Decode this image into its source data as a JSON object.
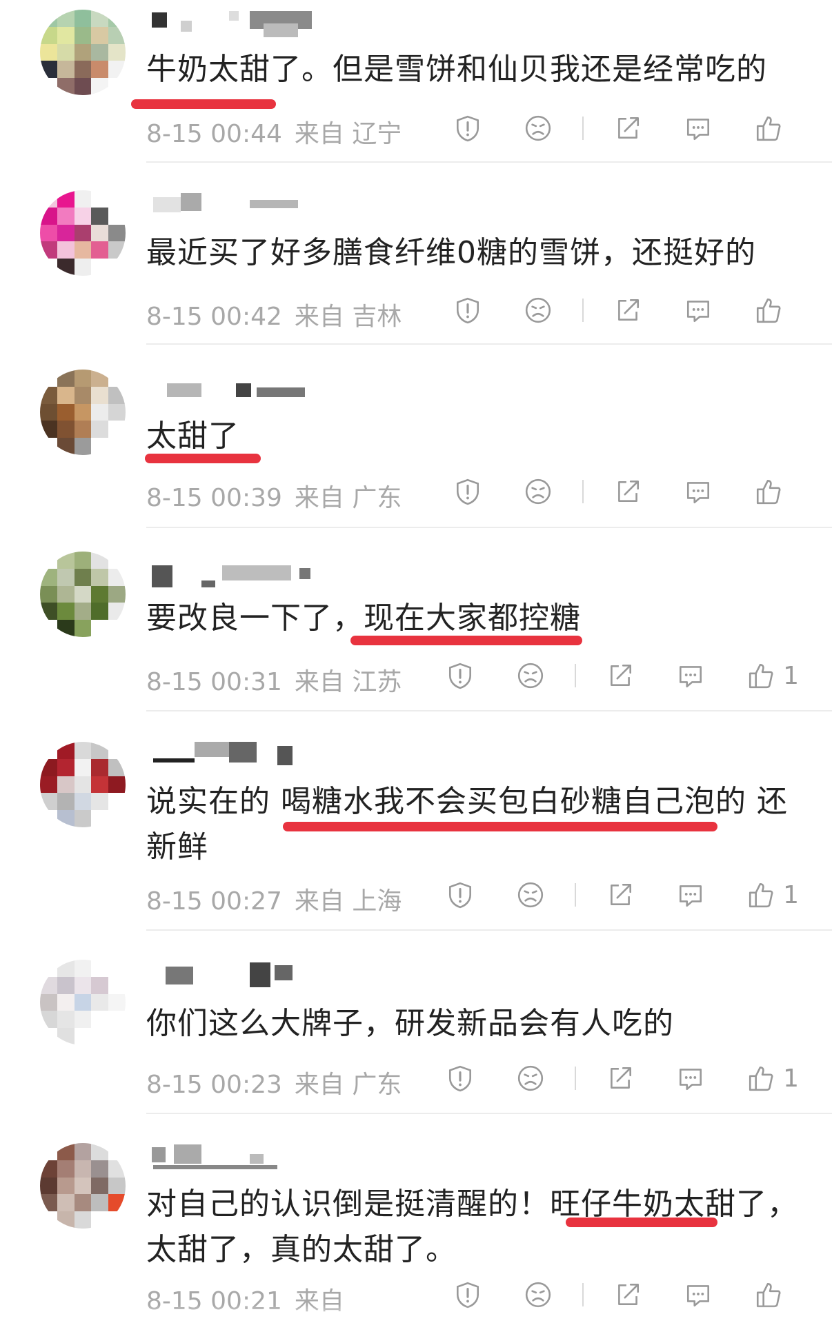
{
  "comments": [
    {
      "text": "牛奶太甜了。但是雪饼和仙贝我还是经常吃的",
      "time": "8-15 00:44",
      "from": "来自",
      "location": "辽宁",
      "likes": ""
    },
    {
      "text": "最近买了好多膳食纤维0糖的雪饼，还挺好的",
      "time": "8-15 00:42",
      "from": "来自",
      "location": "吉林",
      "likes": ""
    },
    {
      "text": "太甜了",
      "time": "8-15 00:39",
      "from": "来自",
      "location": "广东",
      "likes": ""
    },
    {
      "text": "要改良一下了，现在大家都控糖",
      "time": "8-15 00:31",
      "from": "来自",
      "location": "江苏",
      "likes": "1"
    },
    {
      "text": "说实在的 喝糖水我不会买包白砂糖自己泡的 还新鲜",
      "time": "8-15 00:27",
      "from": "来自",
      "location": "上海",
      "likes": "1"
    },
    {
      "text": "你们这么大牌子，研发新品会有人吃的",
      "time": "8-15 00:23",
      "from": "来自",
      "location": "广东",
      "likes": "1"
    },
    {
      "text": "对自己的认识倒是挺清醒的！旺仔牛奶太甜了，太甜了，真的太甜了。",
      "time": "8-15 00:21",
      "from": "来自",
      "location": "",
      "likes": ""
    }
  ],
  "icons": [
    "report-icon",
    "dislike-icon",
    "share-icon",
    "reply-icon",
    "like-icon"
  ],
  "colors": {
    "accent_underline": "#e8333f",
    "meta_text": "#a8a8a8",
    "body_text": "#222222",
    "icon_stroke": "#999999"
  }
}
